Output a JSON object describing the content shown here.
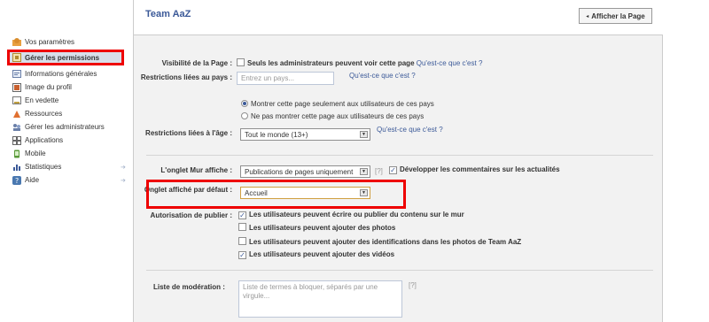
{
  "sidebar": {
    "items": [
      {
        "label": "Vos paramètres",
        "icon": "settings-icon"
      },
      {
        "label": "Gérer les permissions",
        "icon": "permissions-icon"
      },
      {
        "label": "Informations générales",
        "icon": "info-icon"
      },
      {
        "label": "Image du profil",
        "icon": "profile-image-icon"
      },
      {
        "label": "En vedette",
        "icon": "featured-icon"
      },
      {
        "label": "Ressources",
        "icon": "resources-icon"
      },
      {
        "label": "Gérer les administrateurs",
        "icon": "admins-icon"
      },
      {
        "label": "Applications",
        "icon": "apps-icon"
      },
      {
        "label": "Mobile",
        "icon": "mobile-icon"
      },
      {
        "label": "Statistiques",
        "icon": "stats-icon"
      },
      {
        "label": "Aide",
        "icon": "help-icon"
      }
    ]
  },
  "header": {
    "title": "Team AaZ",
    "view_page_label": "Afficher la Page"
  },
  "form": {
    "visibility": {
      "label": "Visibilité de la Page :",
      "checkbox_label": "Seuls les administrateurs peuvent voir cette page",
      "help_link": "Qu'est-ce que c'est ?"
    },
    "country": {
      "label": "Restrictions liées au pays :",
      "placeholder": "Entrez un pays...",
      "help_link": "Qu'est-ce que c'est ?",
      "radio_show": "Montrer cette page seulement aux utilisateurs de ces pays",
      "radio_hide": "Ne pas montrer cette page aux utilisateurs de ces pays"
    },
    "age": {
      "label": "Restrictions liées à l'âge :",
      "selected": "Tout le monde (13+)",
      "help_link": "Qu'est-ce que c'est ?"
    },
    "wall": {
      "label": "L'onglet Mur affiche :",
      "selected": "Publications de pages uniquement",
      "help": "[?]",
      "expand_label": "Développer les commentaires sur les actualités"
    },
    "default_tab": {
      "label": "Onglet affiché par défaut :",
      "selected": "Accueil"
    },
    "posting": {
      "label": "Autorisation de publier :",
      "options": [
        {
          "label": "Les utilisateurs peuvent écrire ou publier du contenu sur le mur",
          "checked": true
        },
        {
          "label": "Les utilisateurs peuvent ajouter des photos",
          "checked": false
        },
        {
          "label": "Les utilisateurs peuvent ajouter des identifications dans les photos de Team AaZ",
          "checked": false
        },
        {
          "label": "Les utilisateurs peuvent ajouter des vidéos",
          "checked": true
        }
      ]
    },
    "moderation": {
      "label": "Liste de modération :",
      "placeholder": "Liste de termes à bloquer, séparés par une virgule...",
      "help": "[?]"
    }
  },
  "colors": {
    "accent": "#3b5998",
    "highlight": "#ee0000",
    "active_bg": "#d8dfea"
  }
}
